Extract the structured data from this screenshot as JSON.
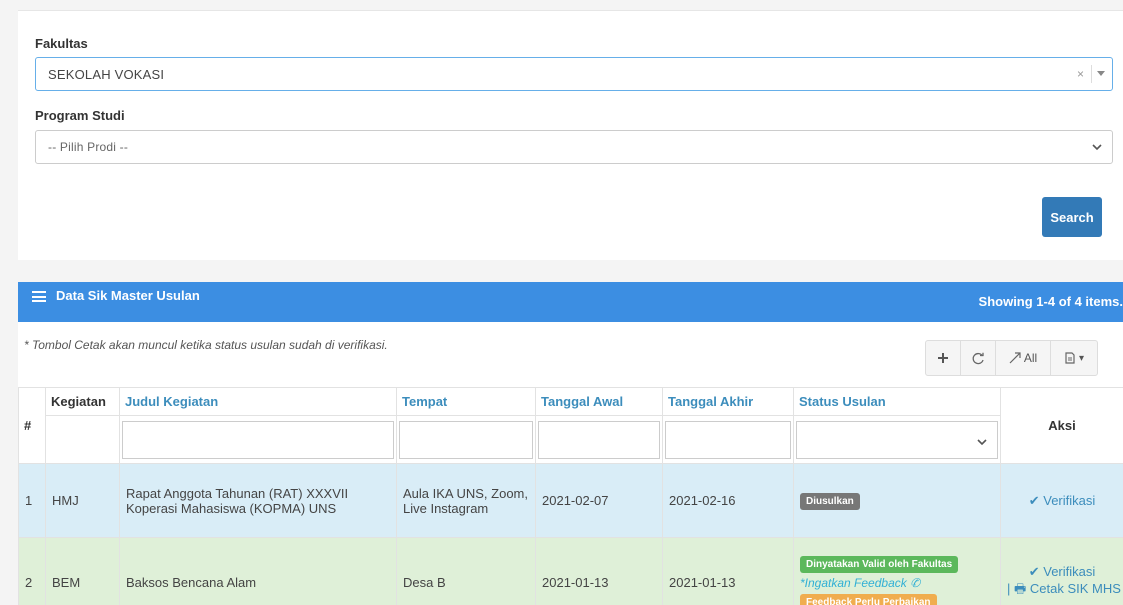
{
  "filter": {
    "fakultas_label": "Fakultas",
    "fakultas_value": "SEKOLAH VOKASI",
    "fakultas_clear": "×",
    "prodi_label": "Program Studi",
    "prodi_value": "-- Pilih Prodi --",
    "search_label": "Search"
  },
  "grid": {
    "title": "Data Sik Master Usulan",
    "summary": "Showing 1-4 of 4 items.",
    "note": "* Tombol Cetak akan muncul ketika status usulan sudah di verifikasi.",
    "toolbar": {
      "add": "+",
      "refresh": "⟳",
      "all": "All",
      "export": "▾"
    },
    "columns": {
      "no": "#",
      "kegiatan": "Kegiatan",
      "judul": "Judul Kegiatan",
      "tempat": "Tempat",
      "tanggal_awal": "Tanggal Awal",
      "tanggal_akhir": "Tanggal Akhir",
      "status": "Status Usulan",
      "aksi": "Aksi"
    },
    "rows": [
      {
        "no": "1",
        "kegiatan": "HMJ",
        "judul": "Rapat Anggota Tahunan (RAT) XXXVII Koperasi Mahasiswa (KOPMA) UNS",
        "tempat": "Aula IKA UNS, Zoom, Live Instagram",
        "tanggal_awal": "2021-02-07",
        "tanggal_akhir": "2021-02-16",
        "status_badge": "Diusulkan",
        "aksi_verifikasi": "✔ Verifikasi"
      },
      {
        "no": "2",
        "kegiatan": "BEM",
        "judul": "Baksos Bencana Alam",
        "tempat": "Desa B",
        "tanggal_awal": "2021-01-13",
        "tanggal_akhir": "2021-01-13",
        "status_badge": "Dinyatakan Valid oleh Fakultas",
        "feedback": "*Ingatkan Feedback ✆",
        "status_badge_2": "Feedback Perlu Perbaikan",
        "aksi_verifikasi": "✔ Verifikasi",
        "aksi_cetak": "| 🖶 Cetak SIK MHS"
      }
    ]
  },
  "colors": {
    "primary": "#337ab7",
    "header_bar": "#3c8ee2",
    "link": "#3c8dbc",
    "row_info": "#d9edf7",
    "row_success": "#dff0d8",
    "badge_default": "#777777",
    "badge_success": "#5cb85c",
    "badge_warning": "#f0ad4e"
  }
}
